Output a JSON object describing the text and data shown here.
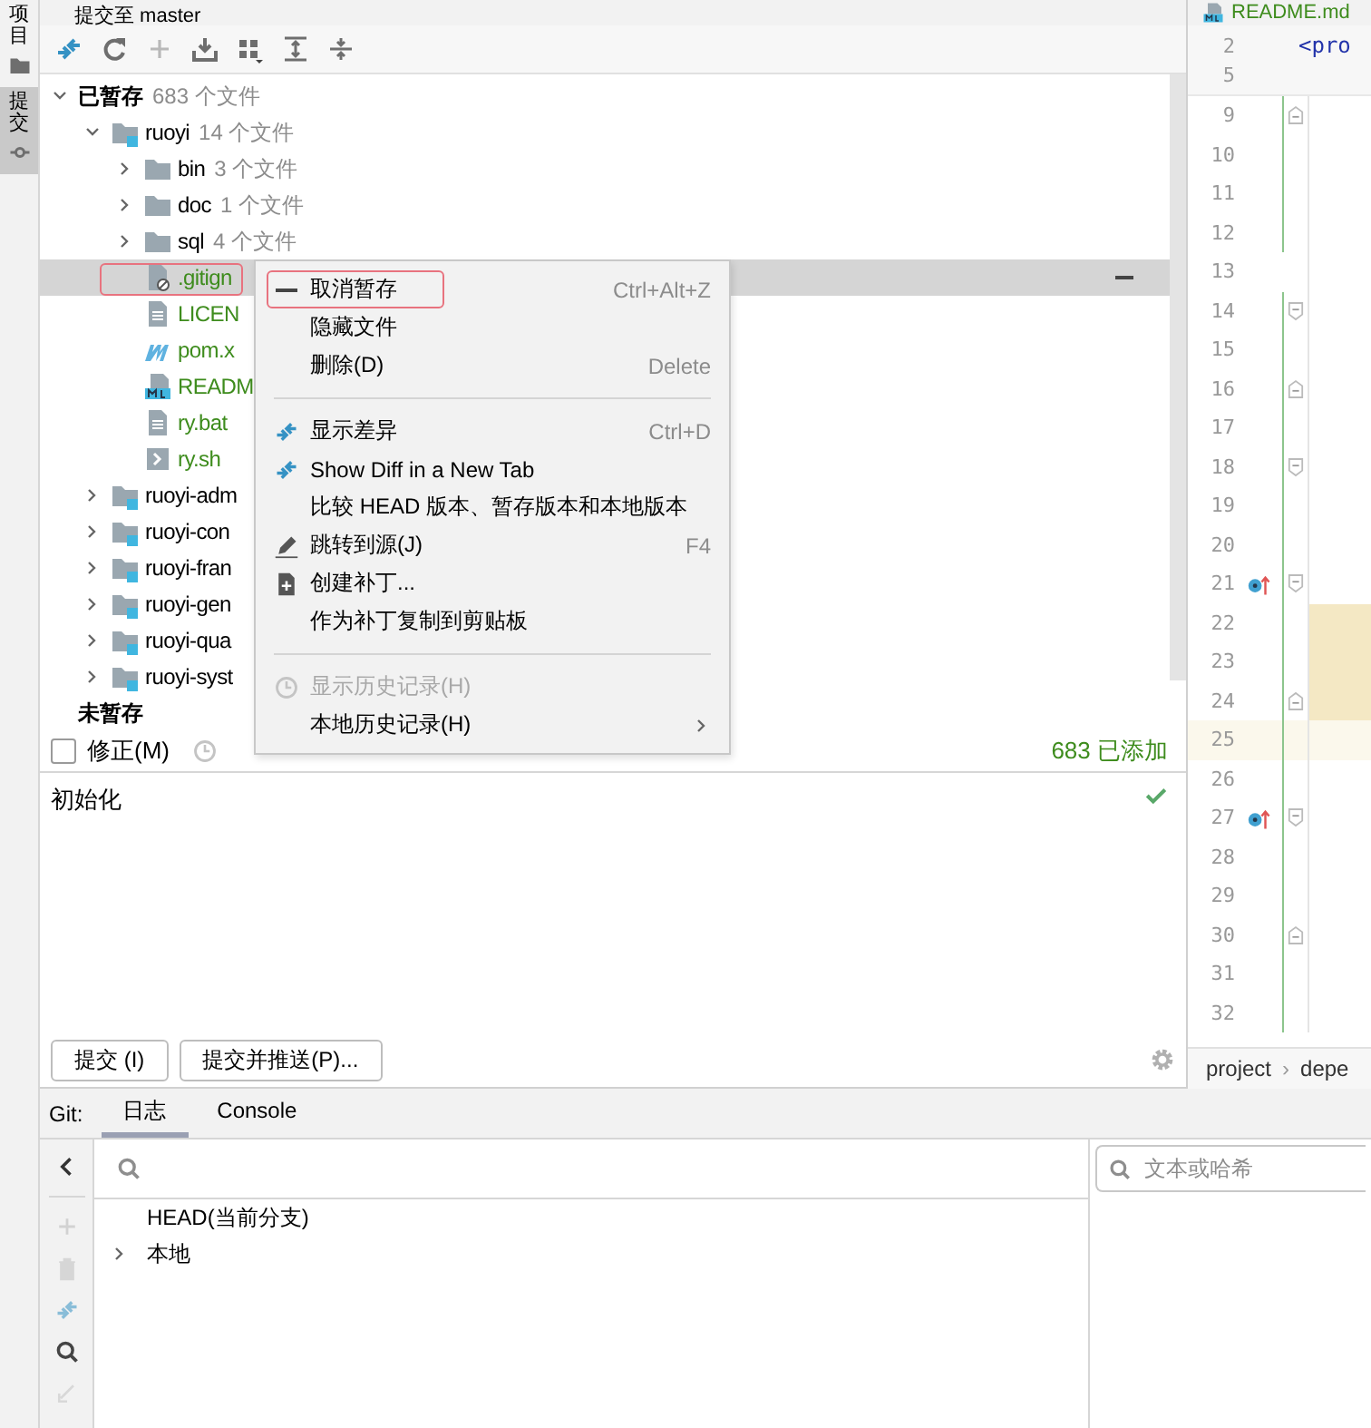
{
  "side_tabs": [
    {
      "label": "项目",
      "kind": "project",
      "selected": false
    },
    {
      "label": "提交",
      "kind": "commit",
      "selected": true
    }
  ],
  "commit_panel": {
    "title": "提交至 master",
    "tree": [
      {
        "label": "已暂存",
        "count": "683 个文件",
        "kind": "group",
        "expanded": true,
        "selected": false,
        "added": false,
        "children": [
          {
            "label": "ruoyi",
            "count": "14 个文件",
            "kind": "module",
            "expanded": true,
            "selected": false,
            "added": false,
            "children": [
              {
                "label": "bin",
                "count": "3 个文件",
                "kind": "folder",
                "expanded": false,
                "selected": false,
                "added": false
              },
              {
                "label": "doc",
                "count": "1 个文件",
                "kind": "folder",
                "expanded": false,
                "selected": false,
                "added": false
              },
              {
                "label": "sql",
                "count": "4 个文件",
                "kind": "folder",
                "expanded": false,
                "selected": false,
                "added": false
              },
              {
                "label": ".gitign",
                "kind": "ignored",
                "selected": true,
                "highlighted": true,
                "added": true
              },
              {
                "label": "LICEN",
                "kind": "text",
                "selected": false,
                "added": true
              },
              {
                "label": "pom.x",
                "kind": "maven",
                "selected": false,
                "added": true
              },
              {
                "label": "READM",
                "kind": "markdown",
                "selected": false,
                "added": true
              },
              {
                "label": "ry.bat",
                "kind": "text",
                "selected": false,
                "added": true
              },
              {
                "label": "ry.sh",
                "kind": "script",
                "selected": false,
                "added": true
              }
            ]
          },
          {
            "label": "ruoyi-adm",
            "kind": "module",
            "expanded": false,
            "selected": false,
            "added": false
          },
          {
            "label": "ruoyi-con",
            "kind": "module",
            "expanded": false,
            "selected": false,
            "added": false
          },
          {
            "label": "ruoyi-fran",
            "kind": "module",
            "expanded": false,
            "selected": false,
            "added": false
          },
          {
            "label": "ruoyi-gen",
            "kind": "module",
            "expanded": false,
            "selected": false,
            "added": false
          },
          {
            "label": "ruoyi-qua",
            "kind": "module",
            "expanded": false,
            "selected": false,
            "added": false
          },
          {
            "label": "ruoyi-syst",
            "kind": "module",
            "expanded": false,
            "selected": false,
            "added": false
          }
        ]
      },
      {
        "label": "未暂存",
        "kind": "group",
        "selected": false,
        "added": false
      }
    ],
    "amend": {
      "label": "修正(M)",
      "checked": false
    },
    "summary": "683 已添加",
    "message": "初始化",
    "buttons": [
      "提交 (I)",
      "提交并推送(P)..."
    ]
  },
  "context_menu": [
    {
      "kind": "unstage",
      "label": "取消暂存",
      "shortcut": "Ctrl+Alt+Z",
      "disabled": false,
      "highlighted": true
    },
    {
      "kind": "plain",
      "label": "隐藏文件",
      "disabled": false,
      "highlighted": false
    },
    {
      "kind": "plain",
      "label": "删除(D)",
      "shortcut": "Delete",
      "disabled": false,
      "highlighted": false
    },
    {
      "kind": "separator"
    },
    {
      "kind": "diff",
      "label": "显示差异",
      "shortcut": "Ctrl+D",
      "disabled": false,
      "highlighted": false
    },
    {
      "kind": "diff",
      "label": "Show Diff in a New Tab",
      "disabled": false,
      "highlighted": false
    },
    {
      "kind": "plain",
      "label": "比较 HEAD 版本、暂存版本和本地版本",
      "disabled": false,
      "highlighted": false
    },
    {
      "kind": "edit",
      "label": "跳转到源(J)",
      "shortcut": "F4",
      "disabled": false,
      "highlighted": false
    },
    {
      "kind": "patch",
      "label": "创建补丁...",
      "disabled": false,
      "highlighted": false
    },
    {
      "kind": "plain",
      "label": "作为补丁复制到剪贴板",
      "disabled": false,
      "highlighted": false
    },
    {
      "kind": "separator"
    },
    {
      "kind": "history",
      "label": "显示历史记录(H)",
      "disabled": true,
      "highlighted": false
    },
    {
      "kind": "submenu",
      "label": "本地历史记录(H)",
      "disabled": false,
      "highlighted": false
    }
  ],
  "editor": {
    "tab": "README.md",
    "sticky": [
      {
        "number": "2",
        "code": "<pro"
      },
      {
        "number": "5"
      }
    ],
    "lines": [
      {
        "number": "9",
        "changed": true,
        "kind": "fold-start"
      },
      {
        "number": "10",
        "changed": true,
        "kind": "plain"
      },
      {
        "number": "11",
        "changed": true,
        "kind": "plain"
      },
      {
        "number": "12",
        "changed": true,
        "kind": "plain"
      },
      {
        "number": "13",
        "changed": false,
        "kind": "plain"
      },
      {
        "number": "14",
        "changed": true,
        "kind": "fold-end"
      },
      {
        "number": "15",
        "changed": true,
        "kind": "plain"
      },
      {
        "number": "16",
        "changed": true,
        "kind": "fold-start"
      },
      {
        "number": "17",
        "changed": true,
        "kind": "plain"
      },
      {
        "number": "18",
        "changed": true,
        "kind": "fold-end"
      },
      {
        "number": "19",
        "changed": true,
        "kind": "plain"
      },
      {
        "number": "20",
        "changed": true,
        "kind": "plain"
      },
      {
        "number": "21",
        "changed": true,
        "kind": "fold-end",
        "marker": true
      },
      {
        "number": "22",
        "changed": true,
        "kind": "plain",
        "block_highlight": true
      },
      {
        "number": "23",
        "changed": true,
        "kind": "plain",
        "block_highlight": true
      },
      {
        "number": "24",
        "changed": true,
        "kind": "fold-start",
        "block_highlight": true
      },
      {
        "number": "25",
        "changed": true,
        "kind": "plain",
        "current_line": true
      },
      {
        "number": "26",
        "changed": true,
        "kind": "plain"
      },
      {
        "number": "27",
        "changed": true,
        "kind": "fold-end",
        "marker": true
      },
      {
        "number": "28",
        "changed": true,
        "kind": "plain"
      },
      {
        "number": "29",
        "changed": true,
        "kind": "plain"
      },
      {
        "number": "30",
        "changed": true,
        "kind": "fold-start"
      },
      {
        "number": "31",
        "changed": true,
        "kind": "plain"
      },
      {
        "number": "32",
        "changed": true,
        "kind": "plain"
      }
    ],
    "breadcrumb": {
      "items": [
        "project",
        "depe"
      ],
      "separator": "›"
    }
  },
  "git_panel": {
    "label": "Git:",
    "tabs": [
      {
        "label": "日志",
        "selected": true
      },
      {
        "label": "Console",
        "selected": false
      }
    ],
    "tools": [
      {
        "kind": "add",
        "disabled": true
      },
      {
        "kind": "trash",
        "disabled": true
      },
      {
        "kind": "diff",
        "disabled": true
      },
      {
        "kind": "search",
        "disabled": false
      },
      {
        "kind": "edit",
        "disabled": true
      }
    ],
    "branches": [
      {
        "label": "HEAD(当前分支)",
        "expandable": false
      },
      {
        "label": "本地",
        "expandable": true
      }
    ],
    "filter": {
      "placeholder": "文本或哈希"
    }
  }
}
